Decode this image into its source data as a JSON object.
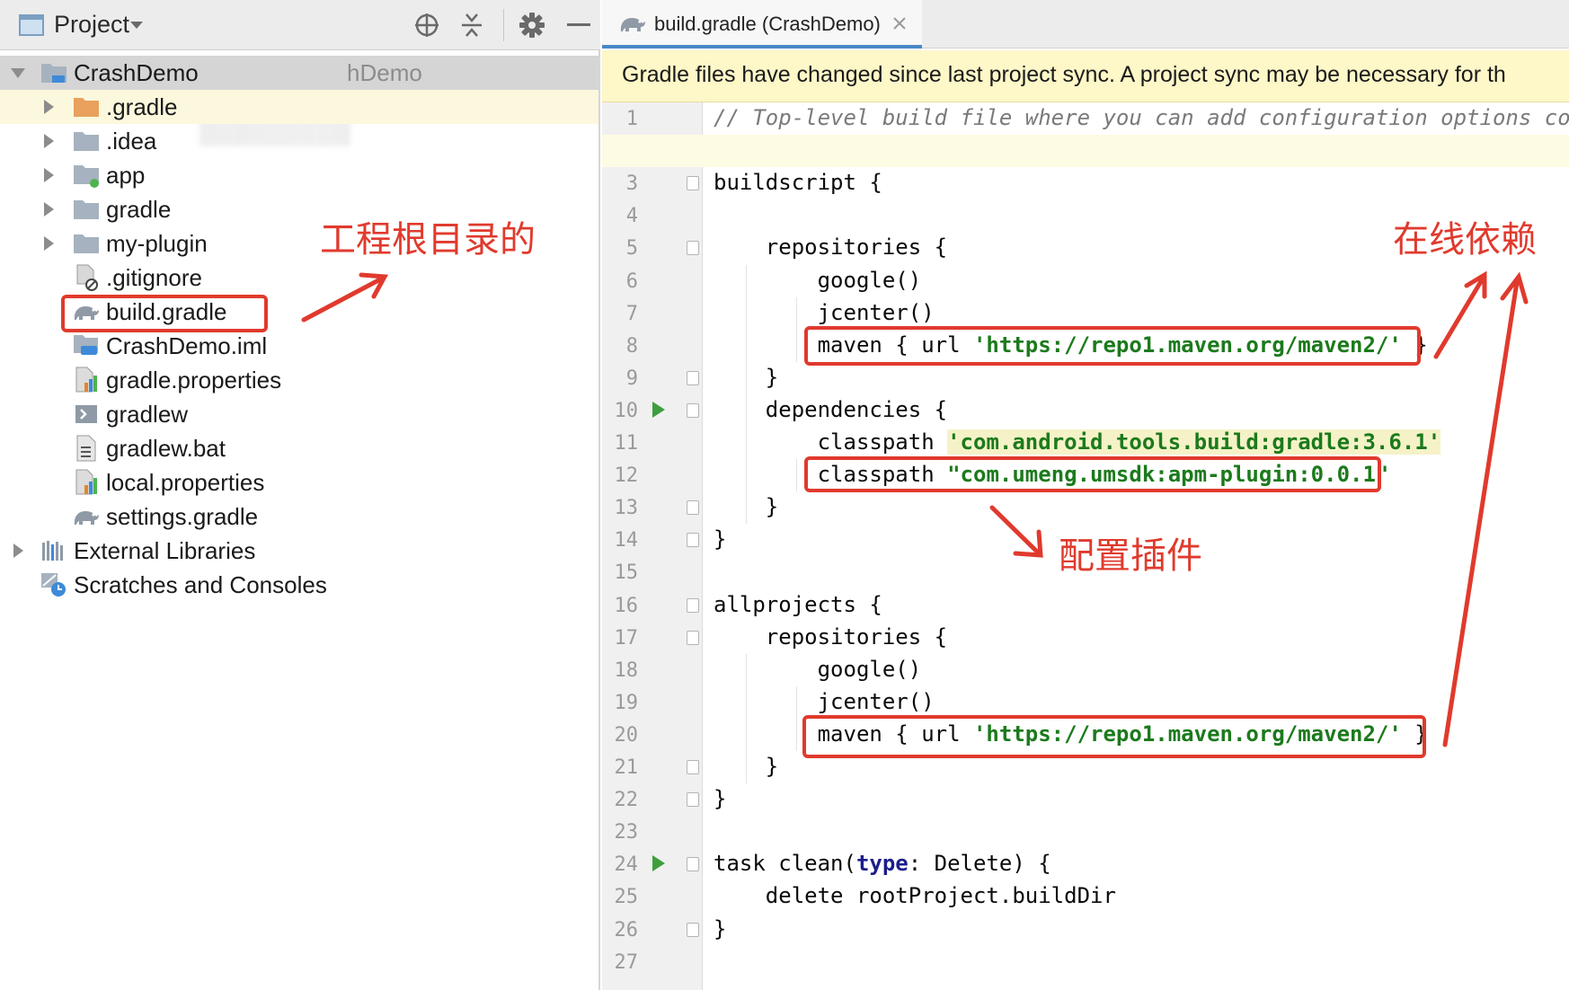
{
  "project_panel": {
    "title": "Project",
    "toolbar_icons": [
      "target-icon",
      "collapse-all-icon",
      "gear-icon",
      "minimize-icon"
    ],
    "tree": [
      {
        "label": "CrashDemo",
        "suffix": "hDemo",
        "icon": "module-folder-icon",
        "expanded": true,
        "level": 0,
        "selected": true
      },
      {
        "label": ".gradle",
        "icon": "orange-folder-icon",
        "expanded": false,
        "level": 1
      },
      {
        "label": ".idea",
        "icon": "folder-icon",
        "expanded": false,
        "level": 1
      },
      {
        "label": "app",
        "icon": "module-folder-icon",
        "expanded": false,
        "level": 1
      },
      {
        "label": "gradle",
        "icon": "folder-icon",
        "expanded": false,
        "level": 1
      },
      {
        "label": "my-plugin",
        "icon": "folder-icon",
        "expanded": false,
        "level": 1
      },
      {
        "label": ".gitignore",
        "icon": "ignored-file-icon",
        "level": 1
      },
      {
        "label": "build.gradle",
        "icon": "gradle-elephant-icon",
        "level": 1
      },
      {
        "label": "CrashDemo.iml",
        "icon": "iml-file-icon",
        "level": 1
      },
      {
        "label": "gradle.properties",
        "icon": "properties-file-icon",
        "level": 1
      },
      {
        "label": "gradlew",
        "icon": "shell-script-icon",
        "level": 1
      },
      {
        "label": "gradlew.bat",
        "icon": "text-file-icon",
        "level": 1
      },
      {
        "label": "local.properties",
        "icon": "properties-file-icon",
        "level": 1
      },
      {
        "label": "settings.gradle",
        "icon": "gradle-elephant-icon",
        "level": 1
      },
      {
        "label": "External Libraries",
        "icon": "libraries-icon",
        "expanded": false,
        "level": 0
      },
      {
        "label": "Scratches and Consoles",
        "icon": "scratches-icon",
        "level": 0
      }
    ]
  },
  "editor": {
    "tab_label": "build.gradle (CrashDemo)",
    "banner": "Gradle files have changed since last project sync. A project sync may be necessary for th",
    "current_line": 2,
    "lines": [
      {
        "n": "1",
        "parts": [
          {
            "t": "// Top-level build file where you can add configuration options comm",
            "c": "cmt"
          }
        ]
      },
      {
        "n": "2",
        "parts": []
      },
      {
        "n": "3",
        "parts": [
          {
            "t": "buildscript {"
          }
        ]
      },
      {
        "n": "4",
        "parts": []
      },
      {
        "n": "5",
        "parts": [
          {
            "t": "    repositories {"
          }
        ]
      },
      {
        "n": "6",
        "parts": [
          {
            "t": "        google()"
          }
        ]
      },
      {
        "n": "7",
        "parts": [
          {
            "t": "        jcenter()"
          }
        ]
      },
      {
        "n": "8",
        "parts": [
          {
            "t": "        maven { url "
          },
          {
            "t": "'https://repo1.maven.org/maven2/'",
            "c": "str"
          },
          {
            "t": " }"
          }
        ]
      },
      {
        "n": "9",
        "parts": [
          {
            "t": "    }"
          }
        ]
      },
      {
        "n": "10",
        "parts": [
          {
            "t": "    dependencies {"
          }
        ]
      },
      {
        "n": "11",
        "parts": [
          {
            "t": "        classpath "
          },
          {
            "t": "'com.android.tools.build:gradle:3.6.1'",
            "c": "str hl"
          }
        ]
      },
      {
        "n": "12",
        "parts": [
          {
            "t": "        classpath "
          },
          {
            "t": "\"com.umeng.umsdk:apm-plugin:0.0.1\"",
            "c": "str"
          }
        ]
      },
      {
        "n": "13",
        "parts": [
          {
            "t": "    }"
          }
        ]
      },
      {
        "n": "14",
        "parts": [
          {
            "t": "}"
          }
        ]
      },
      {
        "n": "15",
        "parts": []
      },
      {
        "n": "16",
        "parts": [
          {
            "t": "allprojects {"
          }
        ]
      },
      {
        "n": "17",
        "parts": [
          {
            "t": "    repositories {"
          }
        ]
      },
      {
        "n": "18",
        "parts": [
          {
            "t": "        google()"
          }
        ]
      },
      {
        "n": "19",
        "parts": [
          {
            "t": "        jcenter()"
          }
        ]
      },
      {
        "n": "20",
        "parts": [
          {
            "t": "        maven { url "
          },
          {
            "t": "'https://repo1.maven.org/maven2/'",
            "c": "str"
          },
          {
            "t": " }"
          }
        ]
      },
      {
        "n": "21",
        "parts": [
          {
            "t": "    }"
          }
        ]
      },
      {
        "n": "22",
        "parts": [
          {
            "t": "}"
          }
        ]
      },
      {
        "n": "23",
        "parts": []
      },
      {
        "n": "24",
        "parts": [
          {
            "t": "task clean("
          },
          {
            "t": "type",
            "c": "kw"
          },
          {
            "t": ": Delete) {"
          }
        ]
      },
      {
        "n": "25",
        "parts": [
          {
            "t": "    delete rootProject.buildDir"
          }
        ]
      },
      {
        "n": "26",
        "parts": [
          {
            "t": "}"
          }
        ]
      },
      {
        "n": "27",
        "parts": []
      }
    ],
    "fold_lines": [
      3,
      5,
      9,
      10,
      13,
      14,
      16,
      17,
      21,
      22,
      24,
      26
    ],
    "run_lines": [
      10,
      24
    ]
  },
  "annotations": {
    "root_dir_label": "工程根目录的",
    "online_deps_label": "在线依赖",
    "config_plugin_label": "配置插件",
    "color": "#e03a2d"
  }
}
